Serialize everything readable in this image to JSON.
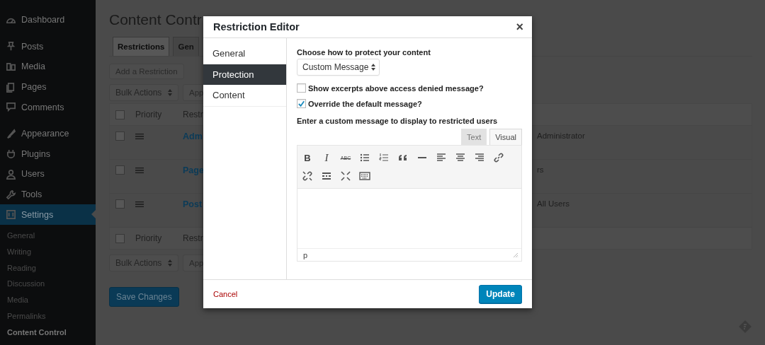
{
  "sidebar": {
    "items": [
      {
        "label": "Dashboard",
        "selected": false
      },
      {
        "label": "Posts",
        "selected": false
      },
      {
        "label": "Media",
        "selected": false
      },
      {
        "label": "Pages",
        "selected": false
      },
      {
        "label": "Comments",
        "selected": false
      },
      {
        "label": "Appearance",
        "selected": false
      },
      {
        "label": "Plugins",
        "selected": false
      },
      {
        "label": "Users",
        "selected": false
      },
      {
        "label": "Tools",
        "selected": false
      },
      {
        "label": "Settings",
        "selected": true
      }
    ],
    "submenu": [
      {
        "label": "General",
        "selected": false
      },
      {
        "label": "Writing",
        "selected": false
      },
      {
        "label": "Reading",
        "selected": false
      },
      {
        "label": "Discussion",
        "selected": false
      },
      {
        "label": "Media",
        "selected": false
      },
      {
        "label": "Permalinks",
        "selected": false
      },
      {
        "label": "Content Control",
        "selected": true
      }
    ]
  },
  "page": {
    "title": "Content Contr",
    "tabs": [
      {
        "label": "Restrictions",
        "selected": true
      },
      {
        "label": "Gen",
        "selected": false
      }
    ],
    "add_button": "Add a Restriction",
    "bulk_top": {
      "select": "Bulk Actions",
      "apply": "App"
    },
    "table": {
      "header": {
        "checked": false,
        "column_2": "Priority",
        "column_3": "Restr"
      },
      "rows": [
        {
          "checked": false,
          "column_3": "Adm",
          "column_4": "Administrator"
        },
        {
          "checked": false,
          "column_3": "Page",
          "column_4": "rs"
        },
        {
          "checked": false,
          "column_3": "Post",
          "column_4": "All Users"
        }
      ],
      "footer": {
        "checked": false,
        "column_2": "Priority",
        "column_3": "Restr"
      }
    },
    "bulk_bottom": {
      "select": "Bulk Actions",
      "apply": "App"
    },
    "save_button": "Save Changes"
  },
  "modal": {
    "title": "Restriction Editor",
    "close": "×",
    "nav": [
      {
        "label": "General",
        "selected": false
      },
      {
        "label": "Protection",
        "selected": true
      },
      {
        "label": "Content",
        "selected": false
      }
    ],
    "protect_label": "Choose how to protect your content",
    "protect_select": "Custom Message",
    "options": [
      {
        "label": "Show excerpts above access denied message?",
        "checked": false
      },
      {
        "label": "Override the default message?",
        "checked": true
      }
    ],
    "message_label": "Enter a custom message to display to restricted users",
    "editor_tabs": [
      {
        "label": "Text",
        "selected": false
      },
      {
        "label": "Visual",
        "selected": true
      }
    ],
    "toolbar": [
      {
        "kind": "bold",
        "glyph": "B"
      },
      {
        "kind": "italic",
        "glyph": "I"
      },
      {
        "kind": "strike",
        "glyph": "ABC"
      },
      {
        "kind": "bullets"
      },
      {
        "kind": "numbers"
      },
      {
        "kind": "quote"
      },
      {
        "kind": "rule"
      },
      {
        "kind": "align-left"
      },
      {
        "kind": "align-center"
      },
      {
        "kind": "align-right"
      },
      {
        "kind": "link"
      },
      {
        "kind": "unlink"
      },
      {
        "kind": "more"
      },
      {
        "kind": "fullscreen"
      },
      {
        "kind": "keyboard"
      }
    ],
    "status_path": "p",
    "cancel": "Cancel",
    "update": "Update"
  }
}
